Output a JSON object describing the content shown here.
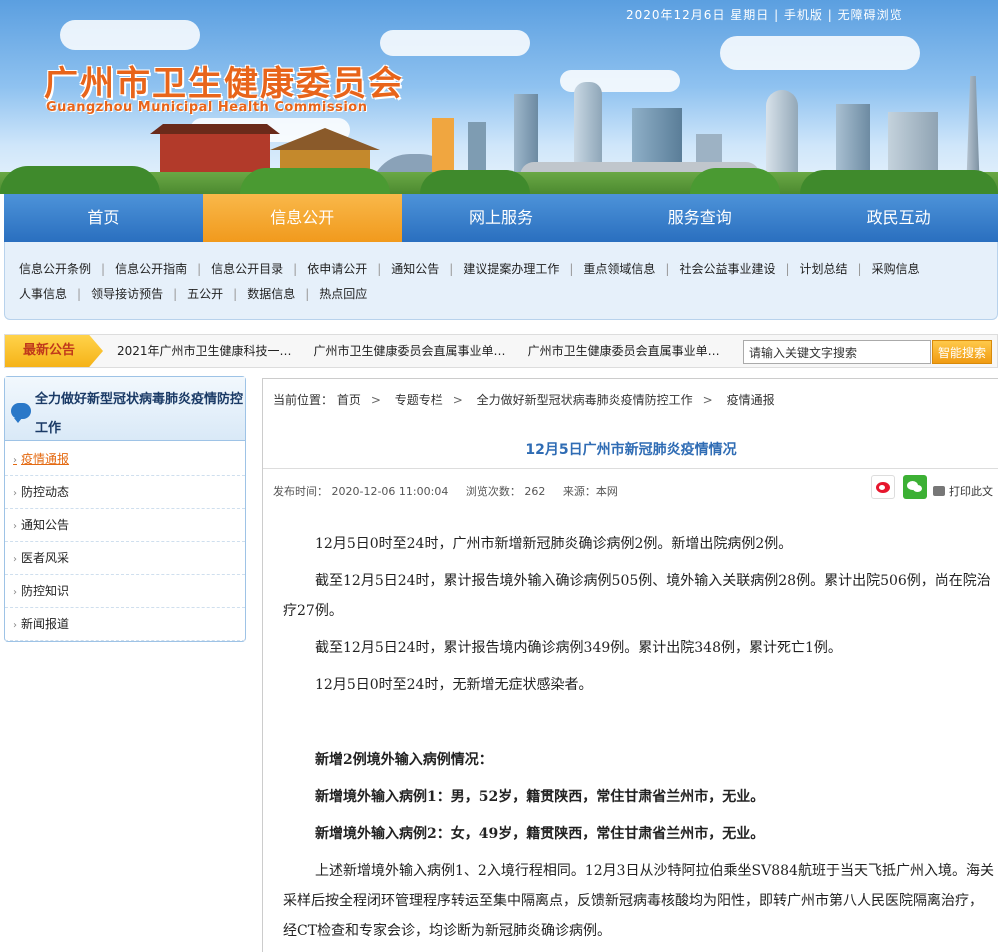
{
  "header": {
    "date_text": "2020年12月6日  星期日  |  手机版  |  无障碍浏览",
    "logo_cn": "广州市卫生健康委员会",
    "logo_en": "Guangzhou Municipal Health Commission"
  },
  "nav": {
    "items": [
      "首页",
      "信息公开",
      "网上服务",
      "服务查询",
      "政民互动"
    ],
    "active": "信息公开"
  },
  "subnav": {
    "row1": [
      "信息公开条例",
      "信息公开指南",
      "信息公开目录",
      "依申请公开",
      "通知公告",
      "建议提案办理工作",
      "重点领域信息",
      "社会公益事业建设",
      "计划总结",
      "采购信息"
    ],
    "row2": [
      "人事信息",
      "领导接访预告",
      "五公开",
      "数据信息",
      "热点回应"
    ]
  },
  "notice": {
    "tag": "最新公告",
    "items": [
      "2021年广州市卫生健康科技一…",
      "广州市卫生健康委员会直属事业单…",
      "广州市卫生健康委员会直属事业单…"
    ],
    "search_placeholder": "请输入关键文字搜索",
    "search_button": "智能搜索"
  },
  "sidebar": {
    "title": "全力做好新型冠状病毒肺炎疫情防控工作",
    "items": [
      "疫情通报",
      "防控动态",
      "通知公告",
      "医者风采",
      "防控知识",
      "新闻报道"
    ],
    "active": "疫情通报"
  },
  "breadcrumb": {
    "prefix": "当前位置：",
    "items": [
      "首页",
      "专题专栏",
      "全力做好新型冠状病毒肺炎疫情防控工作",
      "疫情通报"
    ]
  },
  "article": {
    "title": "12月5日广州市新冠肺炎疫情情况",
    "published": "发布时间： 2020-12-06 11:00:04",
    "views": "浏览次数：  262",
    "source": "来源：本网",
    "print": "打印此文",
    "paragraphs": [
      {
        "text": "12月5日0时至24时，广州市新增新冠肺炎确诊病例2例。新增出院病例2例。",
        "bold": false
      },
      {
        "text": "截至12月5日24时，累计报告境外输入确诊病例505例、境外输入关联病例28例。累计出院506例，尚在院治疗27例。",
        "bold": false
      },
      {
        "text": "截至12月5日24时，累计报告境内确诊病例349例。累计出院348例，累计死亡1例。",
        "bold": false
      },
      {
        "text": "12月5日0时至24时，无新增无症状感染者。",
        "bold": false
      },
      {
        "text": "",
        "gap": true
      },
      {
        "text": "新增2例境外输入病例情况：",
        "bold": true
      },
      {
        "text": "新增境外输入病例1：男，52岁，籍贯陕西，常住甘肃省兰州市，无业。",
        "bold": true
      },
      {
        "text": "新增境外输入病例2：女，49岁，籍贯陕西，常住甘肃省兰州市，无业。",
        "bold": true
      },
      {
        "text": "上述新增境外输入病例1、2入境行程相同。12月3日从沙特阿拉伯乘坐SV884航班于当天飞抵广州入境。海关采样后按全程闭环管理程序转运至集中隔离点，反馈新冠病毒核酸均为阳性，即转广州市第八人民医院隔离治疗，经CT检查和专家会诊，均诊断为新冠肺炎确诊病例。",
        "bold": false
      }
    ]
  },
  "colors": {
    "nav_blue": "#2a6fbf",
    "nav_active": "#f19a1d",
    "title_blue": "#2f6cb4",
    "logo_orange": "#e8641a"
  }
}
